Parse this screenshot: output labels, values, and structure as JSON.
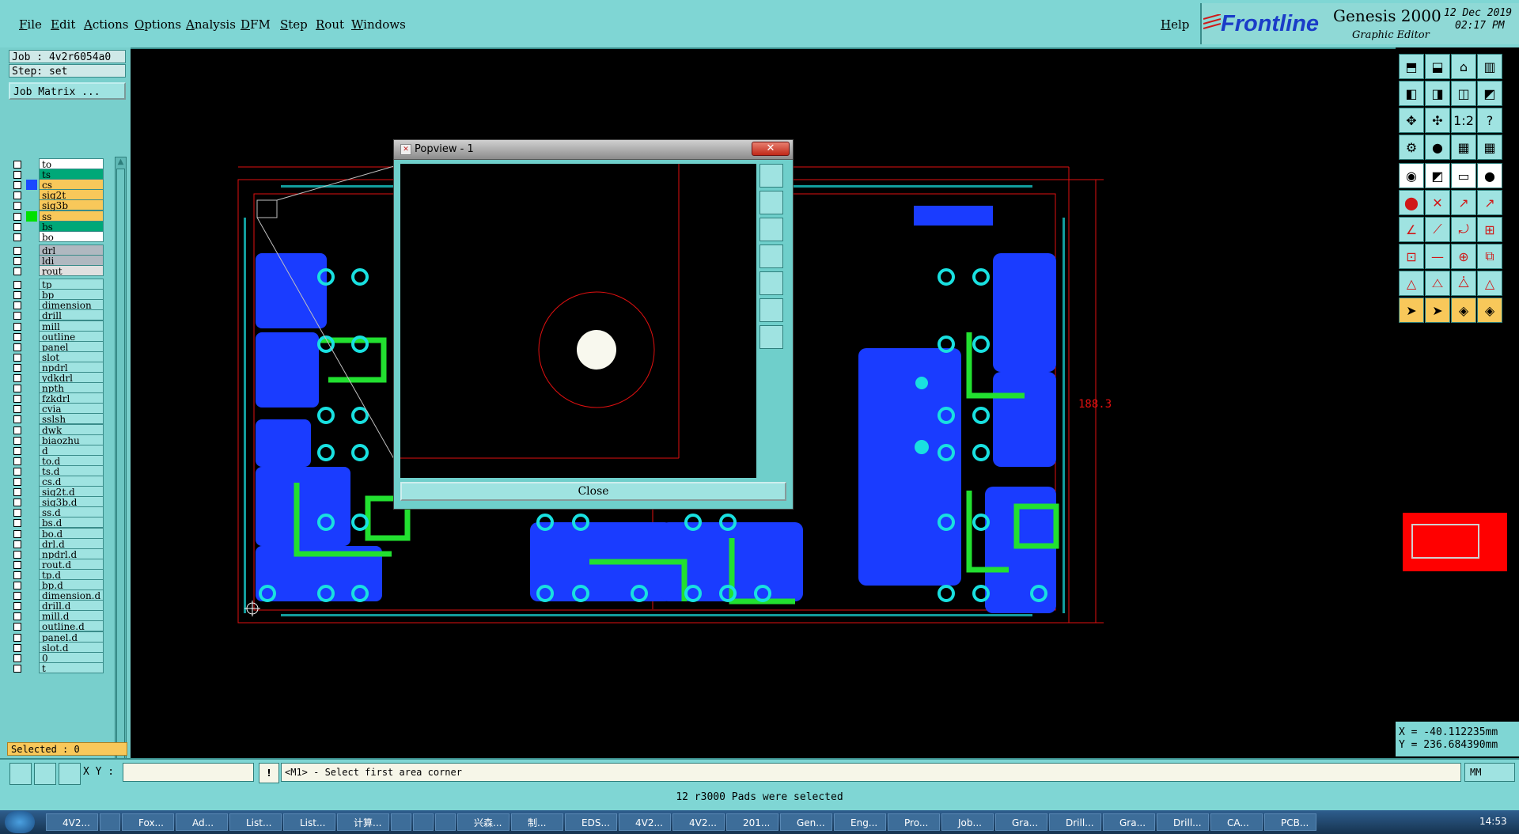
{
  "menubar": {
    "items": [
      "File",
      "Edit",
      "Actions",
      "Options",
      "Analysis",
      "DFM",
      "Step",
      "Rout",
      "Windows"
    ],
    "help": "Help"
  },
  "brand": {
    "logo": "Frontline",
    "product": "Genesis 2000",
    "subtitle": "Graphic Editor",
    "date": "12 Dec 2019",
    "time": "02:17 PM"
  },
  "job": {
    "job_label": "Job : 4v2r6054a0",
    "step_label": "Step: set",
    "matrix_button": "Job Matrix ..."
  },
  "layers_board": [
    {
      "name": "to",
      "color": "#ffffff"
    },
    {
      "name": "ts",
      "color": "#00a878"
    },
    {
      "name": "cs",
      "color": "#f8c85a"
    },
    {
      "name": "sig2t",
      "color": "#f8c85a"
    },
    {
      "name": "sig3b",
      "color": "#f8c85a"
    },
    {
      "name": "ss",
      "color": "#f8c85a"
    },
    {
      "name": "bs",
      "color": "#00a878"
    },
    {
      "name": "bo",
      "color": "#ffffff"
    }
  ],
  "layer_swatches": [
    "",
    "",
    "#1a4aff",
    "",
    "",
    "#00e000",
    "",
    ""
  ],
  "layers_drill": [
    {
      "name": "drl",
      "color": "#b0b8c0"
    },
    {
      "name": "ldi",
      "color": "#b0b8c0"
    },
    {
      "name": "rout",
      "color": "#e0e0e0"
    }
  ],
  "layers_misc": [
    "tp",
    "bp",
    "dimension",
    "drill",
    "mill",
    "outline",
    "panel",
    "slot",
    "npdrl",
    "ydkdrl",
    "npth",
    "fzkdrl",
    "cvia",
    "sslsh",
    "dwk",
    "biaozhu",
    "d",
    "to.d",
    "ts.d",
    "cs.d",
    "sig2t.d",
    "sig3b.d",
    "ss.d",
    "bs.d",
    "bo.d",
    "drl.d",
    "npdrl.d",
    "rout.d",
    "tp.d",
    "bp.d",
    "dimension.d",
    "drill.d",
    "mill.d",
    "outline.d",
    "panel.d",
    "slot.d",
    "0",
    "t"
  ],
  "selected_label": "Selected : 0",
  "popview": {
    "title": "Popview - 1",
    "close_label": "Close"
  },
  "dimension_label": "188.3",
  "coords": {
    "x": "X = -40.112235mm",
    "y": "Y = 236.684390mm"
  },
  "commandbar": {
    "xy_label": "X Y :",
    "xy_value": "",
    "prompt": "<M1> - Select first area corner",
    "units": "MM"
  },
  "status": "12 r3000 Pads were selected",
  "taskbar": {
    "items": [
      "4V2...",
      "",
      "Fox...",
      "Ad...",
      "List...",
      "List...",
      "计算...",
      "",
      "",
      "",
      "兴森...",
      "制...",
      "EDS...",
      "4V2...",
      "4V2...",
      "201...",
      "Gen...",
      "Eng...",
      "Pro...",
      "Job...",
      "Gra...",
      "Drill...",
      "Gra...",
      "Drill...",
      "CA...",
      "PCB..."
    ],
    "clock": "14:53"
  },
  "colors": {
    "teal": "#7fd6d4",
    "board_blue": "#1a3cff",
    "trace_green": "#22e030",
    "pad_cyan": "#19e0e0",
    "outline_red": "#e01010"
  }
}
